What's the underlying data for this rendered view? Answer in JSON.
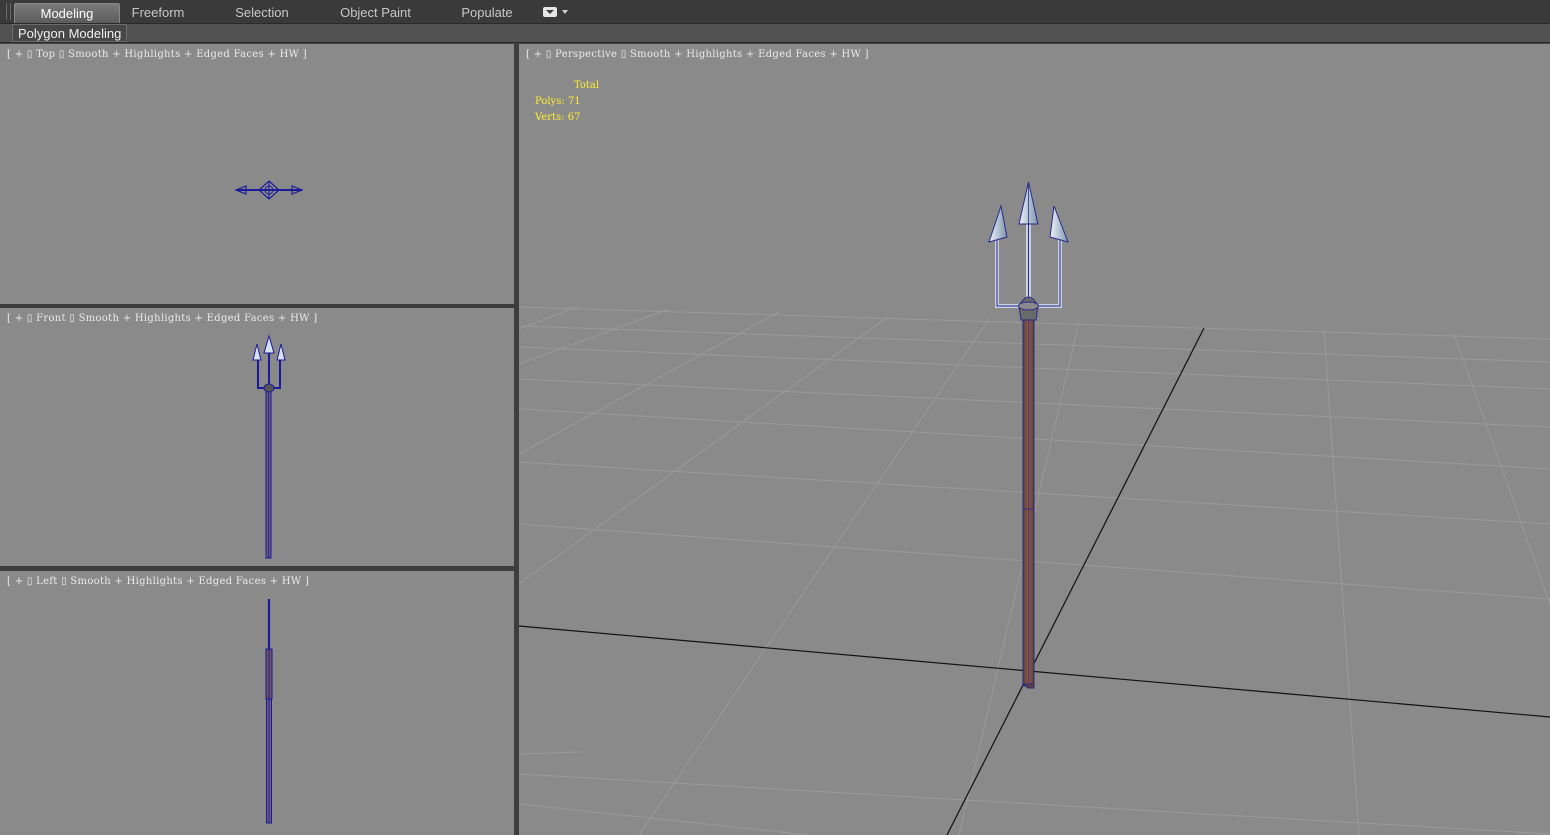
{
  "ribbon": {
    "tabs": [
      {
        "label": "Modeling",
        "active": true
      },
      {
        "label": "Freeform",
        "active": false
      },
      {
        "label": "Selection",
        "active": false
      },
      {
        "label": "Object Paint",
        "active": false
      },
      {
        "label": "Populate",
        "active": false
      }
    ],
    "panel": "Polygon Modeling"
  },
  "viewports": {
    "top": {
      "bracket_open": "[",
      "plus": "+",
      "view": "Top",
      "shading": "Smooth + Highlights",
      "edged": "Edged Faces",
      "hw": "HW",
      "bracket_close": "]"
    },
    "front": {
      "bracket_open": "[",
      "plus": "+",
      "view": "Front",
      "shading": "Smooth + Highlights",
      "edged": "Edged Faces",
      "hw": "HW",
      "bracket_close": "]"
    },
    "left": {
      "bracket_open": "[",
      "plus": "+",
      "view": "Left",
      "shading": "Smooth + Highlights",
      "edged": "Edged Faces",
      "hw": "HW",
      "bracket_close": "]"
    },
    "perspective": {
      "bracket_open": "[",
      "plus": "+",
      "view": "Perspective",
      "shading": "Smooth + Highlights",
      "edged": "Edged Faces",
      "hw": "HW",
      "bracket_close": "]"
    }
  },
  "stats": {
    "title": "Total",
    "polys_label": "Polys:",
    "polys": "71",
    "verts_label": "Verts:",
    "verts": "67"
  },
  "colors": {
    "viewport_bg": "#8a8a8a",
    "stats_text": "#ffee33",
    "wireframe": "#1a1a9a",
    "shaft": "#7a4d44",
    "blade": "#c6d6e6"
  }
}
